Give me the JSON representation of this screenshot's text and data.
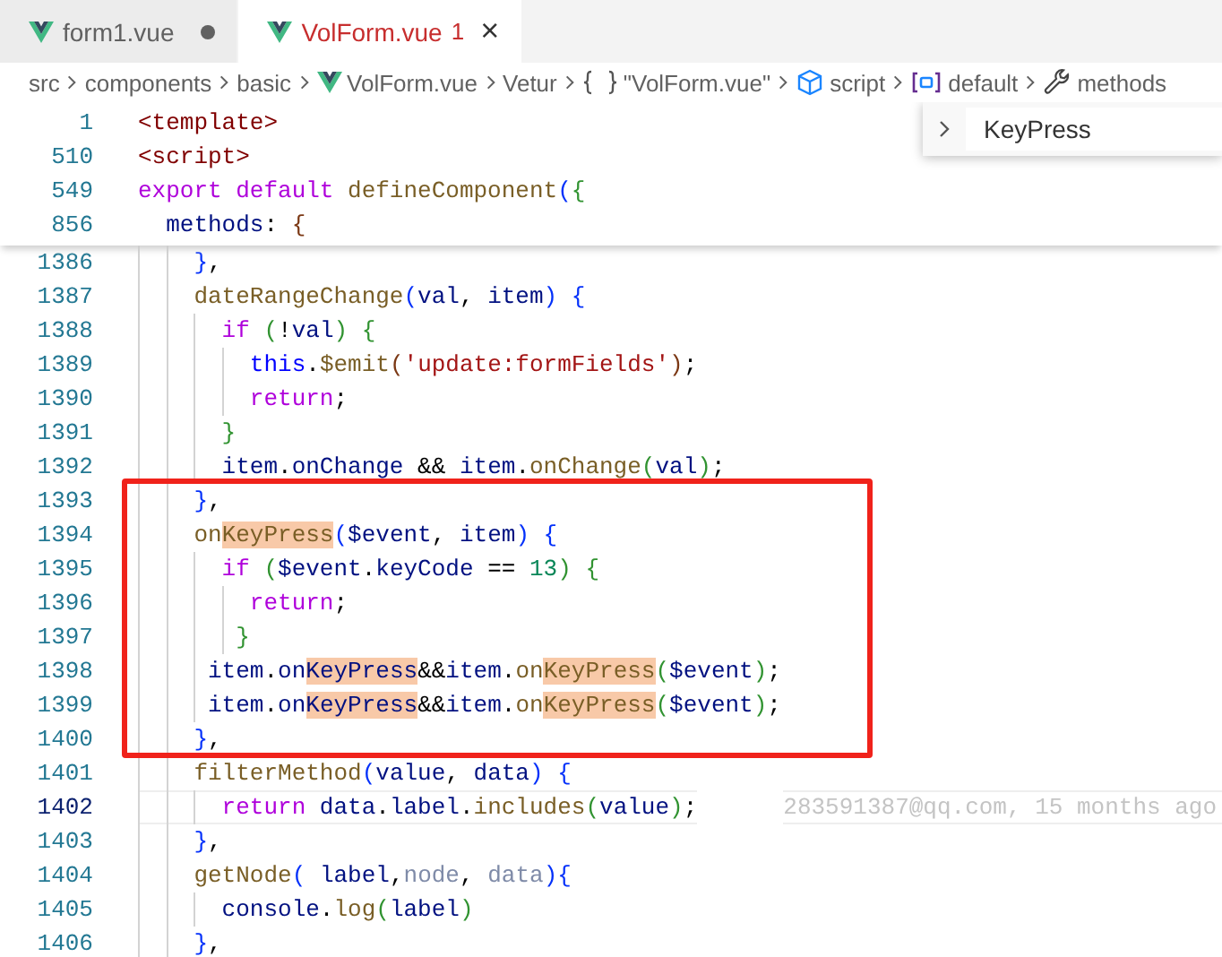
{
  "tabs": [
    {
      "label": "form1.vue",
      "selected": false,
      "modified": true
    },
    {
      "label": "VolForm.vue",
      "selected": true,
      "modified": false,
      "problems": "1",
      "close": "×"
    }
  ],
  "breadcrumb": [
    {
      "text": "src",
      "kind": "folder"
    },
    {
      "text": "components",
      "kind": "folder"
    },
    {
      "text": "basic",
      "kind": "folder"
    },
    {
      "text": "VolForm.vue",
      "kind": "vue"
    },
    {
      "text": "Vetur",
      "kind": "folder"
    },
    {
      "text": "\"VolForm.vue\"",
      "kind": "braces"
    },
    {
      "text": "script",
      "kind": "module"
    },
    {
      "text": "default",
      "kind": "field"
    },
    {
      "text": "methods",
      "kind": "method"
    }
  ],
  "sticky_lines": [
    {
      "number": "1",
      "current": false,
      "tokens": [
        {
          "text": "<template>",
          "kind": "tag",
          "highlighted": false
        }
      ]
    },
    {
      "number": "510",
      "current": false,
      "tokens": [
        {
          "text": "<script>",
          "kind": "tag",
          "highlighted": false
        }
      ]
    },
    {
      "number": "549",
      "current": false,
      "tokens": [
        {
          "text": "export default ",
          "kind": "kw",
          "highlighted": false
        },
        {
          "text": "defineComponent",
          "kind": "fn",
          "highlighted": false
        },
        {
          "text": "(",
          "kind": "b1",
          "highlighted": false
        },
        {
          "text": "{",
          "kind": "b2",
          "highlighted": false
        }
      ]
    },
    {
      "number": "856",
      "current": false,
      "tokens": [
        {
          "text": "  methods",
          "kind": "var",
          "highlighted": false
        },
        {
          "text": ": ",
          "kind": "plain",
          "highlighted": false
        },
        {
          "text": "{",
          "kind": "b3",
          "highlighted": false
        }
      ]
    }
  ],
  "peek": {
    "text": "KeyPress"
  },
  "lines": [
    {
      "number": "1386",
      "current": false,
      "tokens": [
        {
          "text": "    }",
          "kind": "b1",
          "highlighted": false
        },
        {
          "text": ",",
          "kind": "plain",
          "highlighted": false
        }
      ]
    },
    {
      "number": "1387",
      "current": false,
      "tokens": [
        {
          "text": "    dateRangeChange",
          "kind": "fn",
          "highlighted": false
        },
        {
          "text": "(",
          "kind": "b1",
          "highlighted": false
        },
        {
          "text": "val",
          "kind": "var",
          "highlighted": false
        },
        {
          "text": ", ",
          "kind": "plain",
          "highlighted": false
        },
        {
          "text": "item",
          "kind": "var",
          "highlighted": false
        },
        {
          "text": ") ",
          "kind": "b1",
          "highlighted": false
        },
        {
          "text": "{",
          "kind": "b1",
          "highlighted": false
        }
      ]
    },
    {
      "number": "1388",
      "current": false,
      "tokens": [
        {
          "text": "      if ",
          "kind": "kw",
          "highlighted": false
        },
        {
          "text": "(",
          "kind": "b2",
          "highlighted": false
        },
        {
          "text": "!",
          "kind": "plain",
          "highlighted": false
        },
        {
          "text": "val",
          "kind": "var",
          "highlighted": false
        },
        {
          "text": ") ",
          "kind": "b2",
          "highlighted": false
        },
        {
          "text": "{",
          "kind": "b2",
          "highlighted": false
        }
      ]
    },
    {
      "number": "1389",
      "current": false,
      "tokens": [
        {
          "text": "        this",
          "kind": "this",
          "highlighted": false
        },
        {
          "text": ".",
          "kind": "plain",
          "highlighted": false
        },
        {
          "text": "$emit",
          "kind": "fn",
          "highlighted": false
        },
        {
          "text": "(",
          "kind": "b3",
          "highlighted": false
        },
        {
          "text": "'update:formFields'",
          "kind": "str",
          "highlighted": false
        },
        {
          "text": ")",
          "kind": "b3",
          "highlighted": false
        },
        {
          "text": ";",
          "kind": "plain",
          "highlighted": false
        }
      ]
    },
    {
      "number": "1390",
      "current": false,
      "tokens": [
        {
          "text": "        return",
          "kind": "kw",
          "highlighted": false
        },
        {
          "text": ";",
          "kind": "plain",
          "highlighted": false
        }
      ]
    },
    {
      "number": "1391",
      "current": false,
      "tokens": [
        {
          "text": "      }",
          "kind": "b2",
          "highlighted": false
        }
      ]
    },
    {
      "number": "1392",
      "current": false,
      "tokens": [
        {
          "text": "      item",
          "kind": "var",
          "highlighted": false
        },
        {
          "text": ".",
          "kind": "plain",
          "highlighted": false
        },
        {
          "text": "onChange",
          "kind": "var",
          "highlighted": false
        },
        {
          "text": " && ",
          "kind": "plain",
          "highlighted": false
        },
        {
          "text": "item",
          "kind": "var",
          "highlighted": false
        },
        {
          "text": ".",
          "kind": "plain",
          "highlighted": false
        },
        {
          "text": "onChange",
          "kind": "fn",
          "highlighted": false
        },
        {
          "text": "(",
          "kind": "b2",
          "highlighted": false
        },
        {
          "text": "val",
          "kind": "var",
          "highlighted": false
        },
        {
          "text": ")",
          "kind": "b2",
          "highlighted": false
        },
        {
          "text": ";",
          "kind": "plain",
          "highlighted": false
        }
      ]
    },
    {
      "number": "1393",
      "current": false,
      "tokens": [
        {
          "text": "    }",
          "kind": "b1",
          "highlighted": false
        },
        {
          "text": ",",
          "kind": "plain",
          "highlighted": false
        }
      ]
    },
    {
      "number": "1394",
      "current": false,
      "tokens": [
        {
          "text": "    on",
          "kind": "fn",
          "highlighted": false
        },
        {
          "text": "KeyPress",
          "kind": "fn",
          "highlighted": true
        },
        {
          "text": "(",
          "kind": "b1",
          "highlighted": false
        },
        {
          "text": "$event",
          "kind": "var",
          "highlighted": false
        },
        {
          "text": ", ",
          "kind": "plain",
          "highlighted": false
        },
        {
          "text": "item",
          "kind": "var",
          "highlighted": false
        },
        {
          "text": ") ",
          "kind": "b1",
          "highlighted": false
        },
        {
          "text": "{",
          "kind": "b1",
          "highlighted": false
        }
      ]
    },
    {
      "number": "1395",
      "current": false,
      "tokens": [
        {
          "text": "      if ",
          "kind": "kw",
          "highlighted": false
        },
        {
          "text": "(",
          "kind": "b2",
          "highlighted": false
        },
        {
          "text": "$event",
          "kind": "var",
          "highlighted": false
        },
        {
          "text": ".",
          "kind": "plain",
          "highlighted": false
        },
        {
          "text": "keyCode",
          "kind": "var",
          "highlighted": false
        },
        {
          "text": " == ",
          "kind": "plain",
          "highlighted": false
        },
        {
          "text": "13",
          "kind": "num",
          "highlighted": false
        },
        {
          "text": ") ",
          "kind": "b2",
          "highlighted": false
        },
        {
          "text": "{",
          "kind": "b2",
          "highlighted": false
        }
      ]
    },
    {
      "number": "1396",
      "current": false,
      "tokens": [
        {
          "text": "        return",
          "kind": "kw",
          "highlighted": false
        },
        {
          "text": ";",
          "kind": "plain",
          "highlighted": false
        }
      ]
    },
    {
      "number": "1397",
      "current": false,
      "tokens": [
        {
          "text": "       }",
          "kind": "b2",
          "highlighted": false
        }
      ]
    },
    {
      "number": "1398",
      "current": false,
      "tokens": [
        {
          "text": "     item",
          "kind": "var",
          "highlighted": false
        },
        {
          "text": ".",
          "kind": "plain",
          "highlighted": false
        },
        {
          "text": "on",
          "kind": "var",
          "highlighted": false
        },
        {
          "text": "KeyPress",
          "kind": "var",
          "highlighted": true
        },
        {
          "text": "&&",
          "kind": "plain",
          "highlighted": false
        },
        {
          "text": "item",
          "kind": "var",
          "highlighted": false
        },
        {
          "text": ".",
          "kind": "plain",
          "highlighted": false
        },
        {
          "text": "on",
          "kind": "fn",
          "highlighted": false
        },
        {
          "text": "KeyPress",
          "kind": "fn",
          "highlighted": true
        },
        {
          "text": "(",
          "kind": "b2",
          "highlighted": false
        },
        {
          "text": "$event",
          "kind": "var",
          "highlighted": false
        },
        {
          "text": ")",
          "kind": "b2",
          "highlighted": false
        },
        {
          "text": ";",
          "kind": "plain",
          "highlighted": false
        }
      ]
    },
    {
      "number": "1399",
      "current": false,
      "tokens": [
        {
          "text": "     item",
          "kind": "var",
          "highlighted": false
        },
        {
          "text": ".",
          "kind": "plain",
          "highlighted": false
        },
        {
          "text": "on",
          "kind": "var",
          "highlighted": false
        },
        {
          "text": "KeyPress",
          "kind": "var",
          "highlighted": true
        },
        {
          "text": "&&",
          "kind": "plain",
          "highlighted": false
        },
        {
          "text": "item",
          "kind": "var",
          "highlighted": false
        },
        {
          "text": ".",
          "kind": "plain",
          "highlighted": false
        },
        {
          "text": "on",
          "kind": "fn",
          "highlighted": false
        },
        {
          "text": "KeyPress",
          "kind": "fn",
          "highlighted": true
        },
        {
          "text": "(",
          "kind": "b2",
          "highlighted": false
        },
        {
          "text": "$event",
          "kind": "var",
          "highlighted": false
        },
        {
          "text": ")",
          "kind": "b2",
          "highlighted": false
        },
        {
          "text": ";",
          "kind": "plain",
          "highlighted": false
        }
      ]
    },
    {
      "number": "1400",
      "current": false,
      "tokens": [
        {
          "text": "    }",
          "kind": "b1",
          "highlighted": false
        },
        {
          "text": ",",
          "kind": "plain",
          "highlighted": false
        }
      ]
    },
    {
      "number": "1401",
      "current": false,
      "tokens": [
        {
          "text": "    filterMethod",
          "kind": "fn",
          "highlighted": false
        },
        {
          "text": "(",
          "kind": "b1",
          "highlighted": false
        },
        {
          "text": "value",
          "kind": "var",
          "highlighted": false
        },
        {
          "text": ", ",
          "kind": "plain",
          "highlighted": false
        },
        {
          "text": "data",
          "kind": "var",
          "highlighted": false
        },
        {
          "text": ") ",
          "kind": "b1",
          "highlighted": false
        },
        {
          "text": "{",
          "kind": "b1",
          "highlighted": false
        }
      ]
    },
    {
      "number": "1402",
      "current": true,
      "blame": "283591387@qq.com, 15 months ago",
      "tokens": [
        {
          "text": "      return ",
          "kind": "kw",
          "highlighted": false
        },
        {
          "text": "data",
          "kind": "var",
          "highlighted": false
        },
        {
          "text": ".",
          "kind": "plain",
          "highlighted": false
        },
        {
          "text": "label",
          "kind": "var",
          "highlighted": false
        },
        {
          "text": ".",
          "kind": "plain",
          "highlighted": false
        },
        {
          "text": "includes",
          "kind": "fn",
          "highlighted": false
        },
        {
          "text": "(",
          "kind": "b2",
          "highlighted": false
        },
        {
          "text": "value",
          "kind": "var",
          "highlighted": false
        },
        {
          "text": ")",
          "kind": "b2",
          "highlighted": false
        },
        {
          "text": ";",
          "kind": "plain",
          "highlighted": false
        }
      ]
    },
    {
      "number": "1403",
      "current": false,
      "tokens": [
        {
          "text": "    }",
          "kind": "b1",
          "highlighted": false
        },
        {
          "text": ",",
          "kind": "plain",
          "highlighted": false
        }
      ]
    },
    {
      "number": "1404",
      "current": false,
      "tokens": [
        {
          "text": "    getNode",
          "kind": "fn",
          "highlighted": false
        },
        {
          "text": "(",
          "kind": "b1",
          "highlighted": false
        },
        {
          "text": " label",
          "kind": "var",
          "highlighted": false
        },
        {
          "text": ",",
          "kind": "plain",
          "highlighted": false
        },
        {
          "text": "node",
          "kind": "unused",
          "highlighted": false
        },
        {
          "text": ", ",
          "kind": "plain",
          "highlighted": false
        },
        {
          "text": "data",
          "kind": "unused",
          "highlighted": false
        },
        {
          "text": ")",
          "kind": "b1",
          "highlighted": false
        },
        {
          "text": "{",
          "kind": "b1",
          "highlighted": false
        }
      ]
    },
    {
      "number": "1405",
      "current": false,
      "tokens": [
        {
          "text": "      console",
          "kind": "var",
          "highlighted": false
        },
        {
          "text": ".",
          "kind": "plain",
          "highlighted": false
        },
        {
          "text": "log",
          "kind": "fn",
          "highlighted": false
        },
        {
          "text": "(",
          "kind": "b2",
          "highlighted": false
        },
        {
          "text": "label",
          "kind": "var",
          "highlighted": false
        },
        {
          "text": ")",
          "kind": "b2",
          "highlighted": false
        }
      ]
    },
    {
      "number": "1406",
      "current": false,
      "tokens": [
        {
          "text": "    }",
          "kind": "b1",
          "highlighted": false
        },
        {
          "text": ",",
          "kind": "plain",
          "highlighted": false
        }
      ]
    }
  ]
}
